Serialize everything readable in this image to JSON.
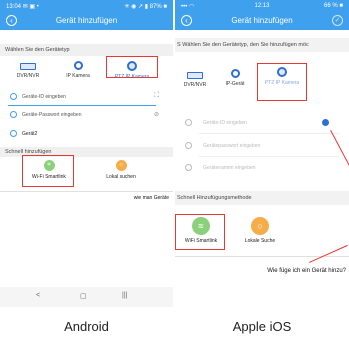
{
  "android": {
    "status": {
      "time": "13:04",
      "left_icons": "✉ ▣ •",
      "right": "✳ ◉ ↗ ▮ 87% ■"
    },
    "title": "Gerät hinzufügen",
    "device_type_heading": "Wählen Sie den Gerätetyp",
    "device_types": [
      {
        "label": "DVR/NVR",
        "icon": "dvr-icon"
      },
      {
        "label": "IP Kamera",
        "icon": "camera-icon"
      },
      {
        "label": "PTZ IP Kamera",
        "icon": "ptz-camera-icon",
        "selected": true
      }
    ],
    "fields": [
      {
        "placeholder": "Geräte-ID eingeben",
        "icon": "id-icon",
        "action_icon": "scan-icon"
      },
      {
        "placeholder": "Geräte-Passwort eingeben",
        "icon": "lock-icon",
        "action_icon": "eye-off-icon"
      },
      {
        "value": "Gerät2",
        "icon": "device-icon"
      }
    ],
    "quick_heading": "Schnell hinzufügen",
    "quick_options": [
      {
        "label": "Wi-Fi Smartlink",
        "icon": "wifi-icon",
        "color": "#8bd17c",
        "selected": true
      },
      {
        "label": "Lokal suchen",
        "icon": "search-icon",
        "color": "#f5ac4a"
      }
    ],
    "help_link": "wie man Geräte",
    "nav": {
      "back": "<",
      "home": "▢",
      "menu": "|||"
    }
  },
  "ios": {
    "status": {
      "signal": "••• ◠",
      "time": "12:13",
      "battery": "66 % ■"
    },
    "title": "Gerät hinzufügen",
    "device_type_heading": "S Wählen Sie den Gerätetyp, den Sie hinzufügen möc",
    "device_types": [
      {
        "label": "DVR/NVR",
        "icon": "dvr-icon"
      },
      {
        "label": "IP-Gerät",
        "icon": "camera-icon"
      },
      {
        "label": "PTZ IP Kamera",
        "icon": "ptz-camera-icon",
        "selected": true
      }
    ],
    "fields": [
      {
        "placeholder": "Geräte-ID eingeben",
        "icon": "id-icon"
      },
      {
        "placeholder": "Gerätepasswort eingeben",
        "icon": "lock-icon"
      },
      {
        "placeholder": "Gerätenamen eingeben",
        "icon": "device-icon"
      }
    ],
    "quick_heading": "Schnell Hinzufügungsmethode",
    "quick_options": [
      {
        "label": "WiFi Smartlink",
        "icon": "wifi-icon",
        "color": "#8bd17c",
        "selected": true
      },
      {
        "label": "Lokale Suche",
        "icon": "search-icon",
        "color": "#f5ac4a"
      }
    ],
    "help_link": "Wie füge ich ein Gerät hinzu?"
  },
  "captions": {
    "android": "Android",
    "ios": "Apple iOS"
  },
  "colors": {
    "header": "#3fa0ee",
    "highlight": "#e53935",
    "icon_blue": "#2f6fd1"
  }
}
